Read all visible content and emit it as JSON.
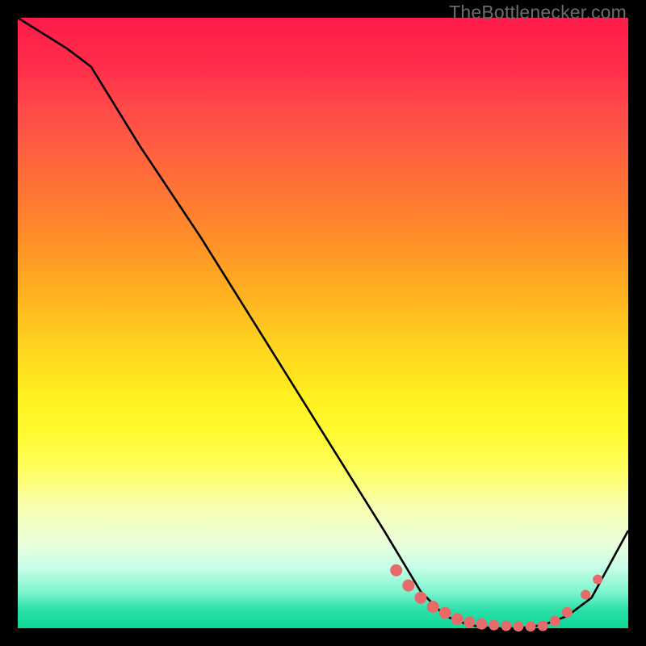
{
  "watermark": "TheBottlenecker.com",
  "chart_data": {
    "type": "line",
    "title": "",
    "xlabel": "",
    "ylabel": "",
    "xlim": [
      0,
      100
    ],
    "ylim": [
      0,
      100
    ],
    "series": [
      {
        "name": "curve",
        "x": [
          0,
          8,
          12,
          20,
          30,
          40,
          50,
          60,
          66,
          70,
          74,
          78,
          82,
          86,
          90,
          94,
          100
        ],
        "values": [
          100,
          95,
          92,
          79,
          64,
          48,
          32,
          16,
          6,
          2,
          0.5,
          0,
          0,
          0.5,
          2,
          5,
          16
        ]
      }
    ],
    "markers": {
      "name": "dots",
      "x": [
        62,
        64,
        66,
        68,
        70,
        72,
        74,
        76,
        78,
        80,
        82,
        84,
        86,
        88,
        90,
        93,
        95
      ],
      "values": [
        9.5,
        7,
        5,
        3.5,
        2.5,
        1.5,
        1,
        0.7,
        0.5,
        0.4,
        0.3,
        0.3,
        0.4,
        1.2,
        2.6,
        5.5,
        8
      ],
      "radius": [
        7,
        7,
        7,
        7,
        7,
        7,
        6.5,
        6.5,
        6,
        6,
        6,
        6,
        6,
        6,
        6,
        5.5,
        5.5
      ]
    },
    "colors": {
      "curve": "#000000",
      "marker_fill": "#e66a6a",
      "marker_stroke": "#e66a6a"
    }
  }
}
